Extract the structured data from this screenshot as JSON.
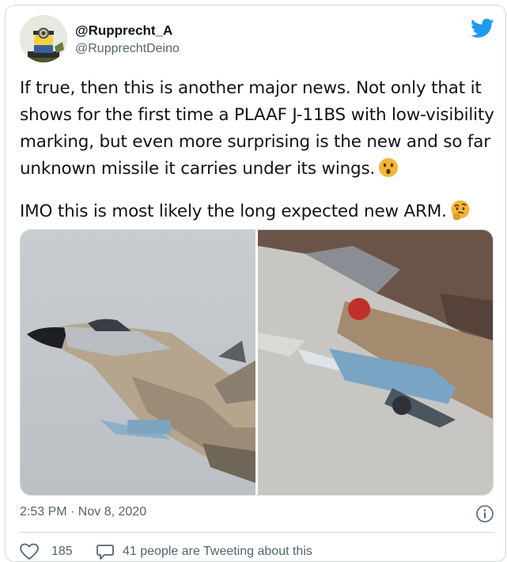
{
  "user": {
    "display_name": "@Rupprecht_A",
    "handle": "@RupprechtDeino"
  },
  "tweet": {
    "paragraph1": "If true, then this is another major news. Not only that it shows for the first time a PLAAF J-11BS with low-visibility marking, but even more surprising is the new and so far unknown missile it carries under its wings.",
    "paragraph2": "IMO this is most likely the long expected new ARM.",
    "emoji1": "surprised-face",
    "emoji2": "thinking-face"
  },
  "meta": {
    "timestamp": "2:53 PM · Nov 8, 2020"
  },
  "engagement": {
    "likes": "185",
    "tweeting_text": "41 people are Tweeting about this"
  },
  "colors": {
    "brand": "#1d9bf0",
    "text": "#0f1419",
    "secondary": "#536471",
    "border": "#cfd9de",
    "emoji": "#f4b532"
  },
  "icons": [
    "twitter-bird-icon",
    "info-icon",
    "heart-icon",
    "comment-icon"
  ]
}
